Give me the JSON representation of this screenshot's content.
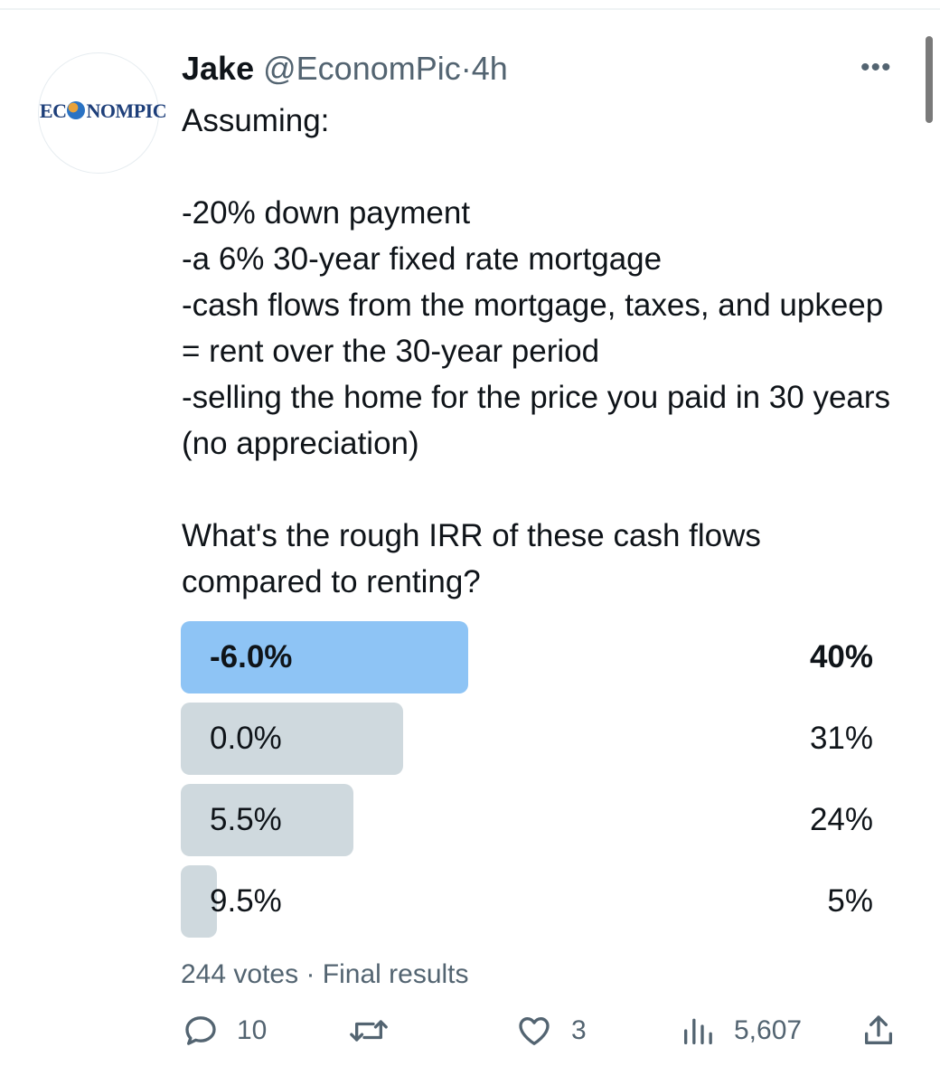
{
  "tweet": {
    "avatar_logo": "EC NOMPIC",
    "avatar_logo_left": "EC",
    "avatar_logo_right": "NOMPIC",
    "author_name": "Jake",
    "handle": "@EconomPic",
    "separator": "·",
    "time": "4h",
    "more_label": "•••",
    "text": "Assuming:\n\n-20% down payment\n-a 6% 30-year fixed rate mortgage\n-cash flows from the mortgage, taxes, and upkeep = rent over the 30-year period\n-selling the home for the price you paid in 30 years (no appreciation)\n\nWhat's the rough IRR of these cash flows compared to renting?"
  },
  "poll": {
    "options": [
      {
        "label": "-6.0%",
        "percent_text": "40%",
        "percent": 40,
        "winner": true
      },
      {
        "label": "0.0%",
        "percent_text": "31%",
        "percent": 31,
        "winner": false
      },
      {
        "label": "5.5%",
        "percent_text": "24%",
        "percent": 24,
        "winner": false
      },
      {
        "label": "9.5%",
        "percent_text": "5%",
        "percent": 5,
        "winner": false
      }
    ],
    "votes": "244 votes",
    "separator": "·",
    "status": "Final results"
  },
  "actions": {
    "reply_count": "10",
    "retweet_count": "",
    "like_count": "3",
    "views_count": "5,607"
  },
  "colors": {
    "winner_bar": "#8ec4f5",
    "other_bar": "#cfd9de",
    "secondary_text": "#536471",
    "primary_text": "#0f1419"
  }
}
